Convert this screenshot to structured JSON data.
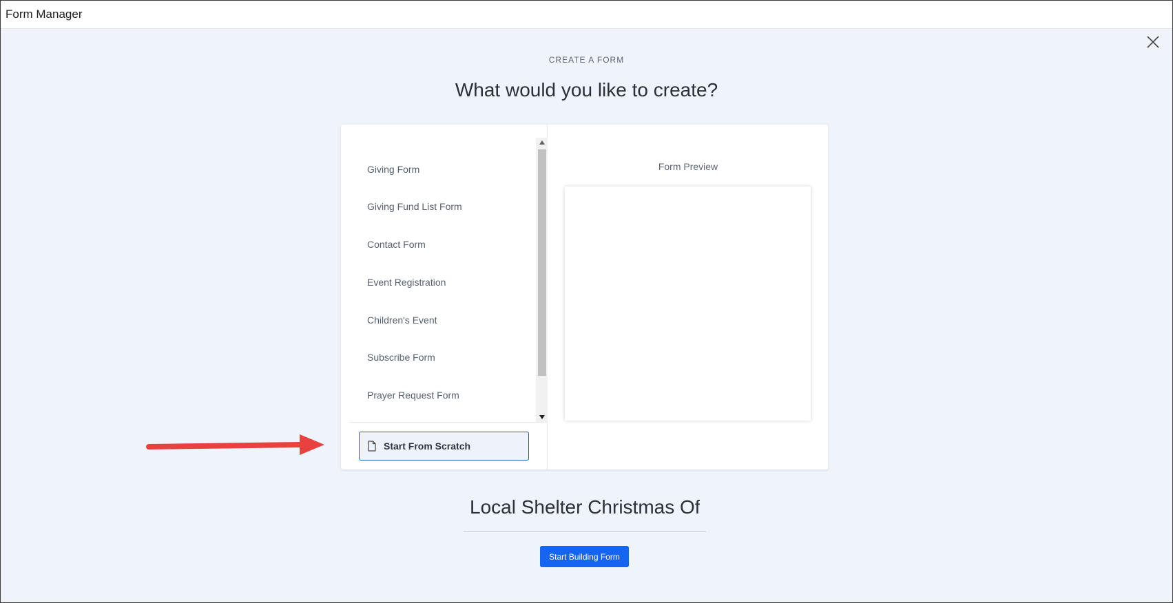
{
  "window": {
    "title": "Form Manager"
  },
  "page": {
    "eyebrow": "CREATE A FORM",
    "heading": "What would you like to create?"
  },
  "templates": {
    "items": [
      {
        "label": "Giving Form"
      },
      {
        "label": "Giving Fund List Form"
      },
      {
        "label": "Contact Form"
      },
      {
        "label": "Event Registration"
      },
      {
        "label": "Children's Event"
      },
      {
        "label": "Subscribe Form"
      },
      {
        "label": "Prayer Request Form"
      }
    ],
    "scratch_label": "Start From Scratch"
  },
  "preview": {
    "label": "Form Preview"
  },
  "form_name": {
    "value": "Local Shelter Christmas Offe"
  },
  "actions": {
    "build_label": "Start Building Form"
  },
  "colors": {
    "accent": "#1565f1",
    "annotation_arrow": "#e8413f",
    "background": "#eff3fa"
  },
  "icons": {
    "close": "close-icon",
    "document": "document-icon",
    "scroll_up": "scroll-up-arrow-icon",
    "scroll_down": "scroll-down-arrow-icon",
    "annotation": "red-arrow-icon"
  }
}
